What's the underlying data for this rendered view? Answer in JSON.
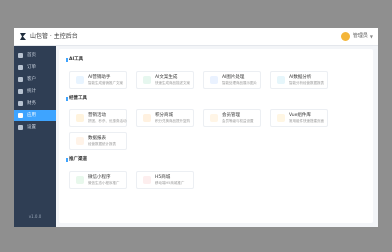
{
  "header": {
    "brand": "山包管 · 主控后台",
    "user_name": "管理员"
  },
  "sidebar": {
    "items": [
      {
        "label": "首页",
        "icon": "home-icon",
        "active": false
      },
      {
        "label": "订单",
        "icon": "order-icon",
        "active": false
      },
      {
        "label": "客户",
        "icon": "customer-icon",
        "active": false
      },
      {
        "label": "统计",
        "icon": "chart-icon",
        "active": false
      },
      {
        "label": "财务",
        "icon": "finance-icon",
        "active": false
      },
      {
        "label": "应用",
        "icon": "app-icon",
        "active": true
      },
      {
        "label": "设置",
        "icon": "gear-icon",
        "active": false
      }
    ],
    "footer": "v1.0.0"
  },
  "sections": [
    {
      "title": "AI工具",
      "cards": [
        {
          "title": "AI营销助手",
          "desc": "智能生成营销推广文案",
          "icon": "chat-icon",
          "color": "#e8f4ff"
        },
        {
          "title": "AI文案生成",
          "desc": "快速生成商品描述文案",
          "icon": "leaf-icon",
          "color": "#e6f7ef"
        },
        {
          "title": "AI图片处理",
          "desc": "智能处理商品展示图片",
          "icon": "image-icon",
          "color": "#eaf2ff"
        },
        {
          "title": "AI数据分析",
          "desc": "智能分析经营数据报表",
          "icon": "data-icon",
          "color": "#e6f6fb"
        }
      ]
    },
    {
      "title": "经营工具",
      "cards": [
        {
          "title": "营销活动",
          "desc": "拼团、秒杀、优惠券活动",
          "icon": "flag-icon",
          "color": "#fff3dd"
        },
        {
          "title": "积分商城",
          "desc": "积分兑换商品提升复购",
          "icon": "gift-icon",
          "color": "#fff1e0"
        },
        {
          "title": "会员管理",
          "desc": "会员等级与权益设置",
          "icon": "member-icon",
          "color": "#fff5e6"
        },
        {
          "title": "Vue组件库",
          "desc": "常用组件快速搭建页面",
          "icon": "smile-icon",
          "color": "#fff6e3"
        },
        {
          "title": "数据报表",
          "desc": "经营数据统计报表",
          "icon": "report-icon",
          "color": "#fff3e8"
        }
      ]
    },
    {
      "title": "推广渠道",
      "cards": [
        {
          "title": "微信小程序",
          "desc": "微信生态小程序推广",
          "icon": "wechat-icon",
          "color": "#e8f8ec"
        },
        {
          "title": "H5商城",
          "desc": "移动端H5商城推广",
          "icon": "colorful-circle-icon",
          "color": "#fdeeee"
        }
      ]
    }
  ]
}
